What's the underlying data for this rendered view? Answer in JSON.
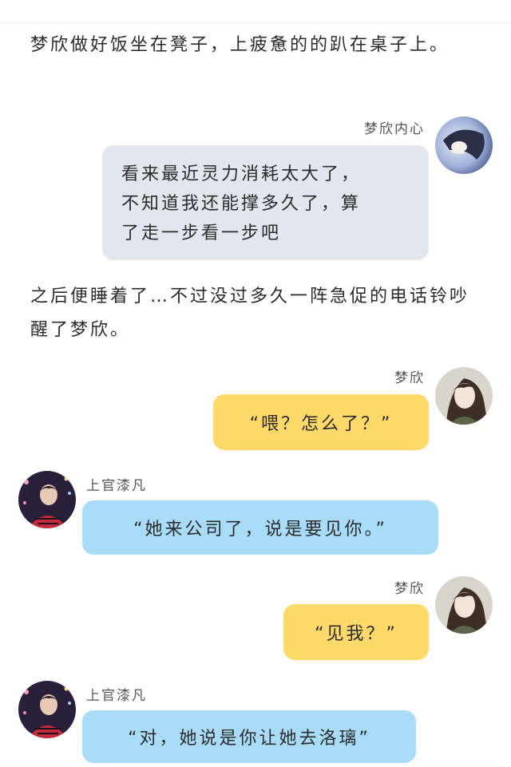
{
  "narration": [
    "梦欣做好饭坐在凳子，上疲惫的的趴在桌子上。",
    "之后便睡着了…不过没过多久一阵急促的电话铃吵醒了梦欣。"
  ],
  "messages": [
    {
      "speaker": "梦欣内心",
      "side": "right",
      "style": "inner-thought",
      "lines": [
        "看来最近灵力消耗太大了，",
        "不知道我还能撑多久了，算",
        "了走一步看一步吧"
      ],
      "avatar_icon": "sleeping-girl-avatar-icon"
    },
    {
      "speaker": "梦欣",
      "side": "right",
      "text": "“喂？怎么了？”",
      "avatar_icon": "girl-avatar-icon"
    },
    {
      "speaker": "上官漆凡",
      "side": "left",
      "text": "“她来公司了，说是要见你。”",
      "avatar_icon": "boy-night-avatar-icon"
    },
    {
      "speaker": "梦欣",
      "side": "right",
      "text": "“见我？”",
      "avatar_icon": "girl-avatar-icon"
    },
    {
      "speaker": "上官漆凡",
      "side": "left",
      "text": "“对，她说是你让她去洛璃”",
      "avatar_icon": "boy-night-avatar-icon"
    }
  ],
  "colors": {
    "inner_thought_bubble": "#e2e6ee",
    "self_bubble": "#ffd96a",
    "other_bubble": "#a9dcf9",
    "background": "#ffffff"
  }
}
